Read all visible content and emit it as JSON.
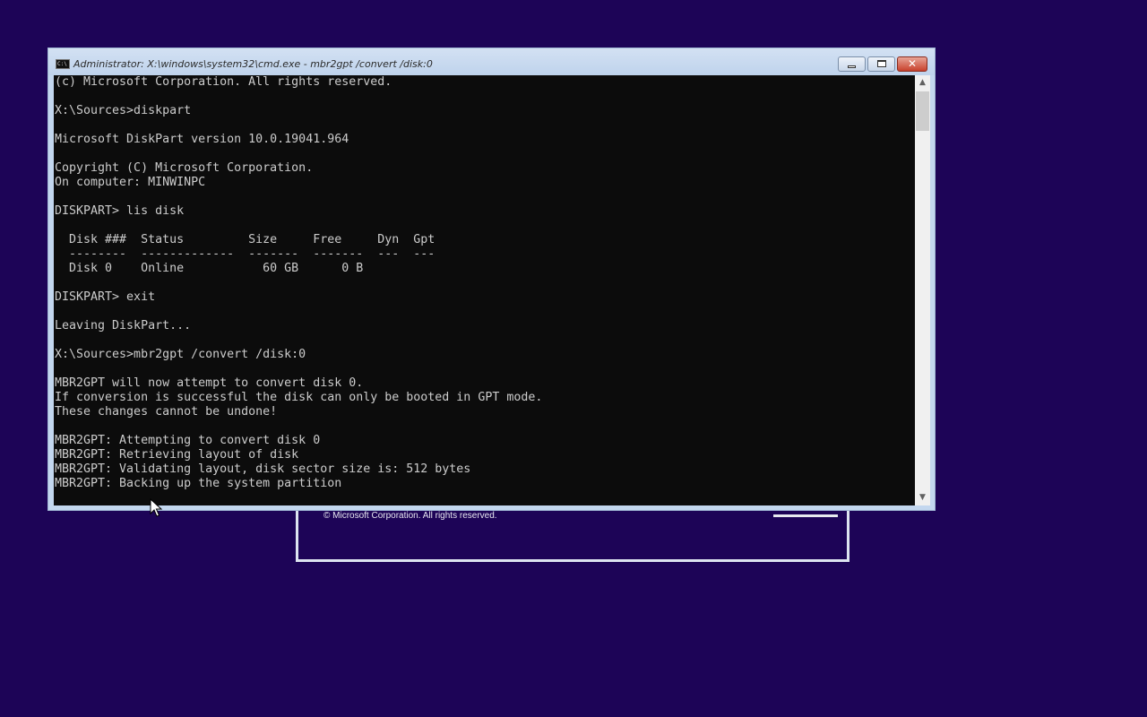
{
  "desktop": {
    "background_color": "#1d0457"
  },
  "setup_window": {
    "copyright": "© Microsoft Corporation. All rights reserved."
  },
  "cmd_window": {
    "title": "Administrator: X:\\windows\\system32\\cmd.exe - mbr2gpt  /convert /disk:0",
    "icon_text": "C:\\",
    "close_glyph": "✕",
    "scroll_up_glyph": "▲",
    "scroll_down_glyph": "▼",
    "console_lines": [
      "(c) Microsoft Corporation. All rights reserved.",
      "",
      "X:\\Sources>diskpart",
      "",
      "Microsoft DiskPart version 10.0.19041.964",
      "",
      "Copyright (C) Microsoft Corporation.",
      "On computer: MINWINPC",
      "",
      "DISKPART> lis disk",
      "",
      "  Disk ###  Status         Size     Free     Dyn  Gpt",
      "  --------  -------------  -------  -------  ---  ---",
      "  Disk 0    Online           60 GB      0 B",
      "",
      "DISKPART> exit",
      "",
      "Leaving DiskPart...",
      "",
      "X:\\Sources>mbr2gpt /convert /disk:0",
      "",
      "MBR2GPT will now attempt to convert disk 0.",
      "If conversion is successful the disk can only be booted in GPT mode.",
      "These changes cannot be undone!",
      "",
      "MBR2GPT: Attempting to convert disk 0",
      "MBR2GPT: Retrieving layout of disk",
      "MBR2GPT: Validating layout, disk sector size is: 512 bytes",
      "MBR2GPT: Backing up the system partition"
    ],
    "colors": {
      "console_background": "#0c0c0c",
      "console_text": "#cccccc",
      "frame": "#c3d7ef"
    }
  }
}
